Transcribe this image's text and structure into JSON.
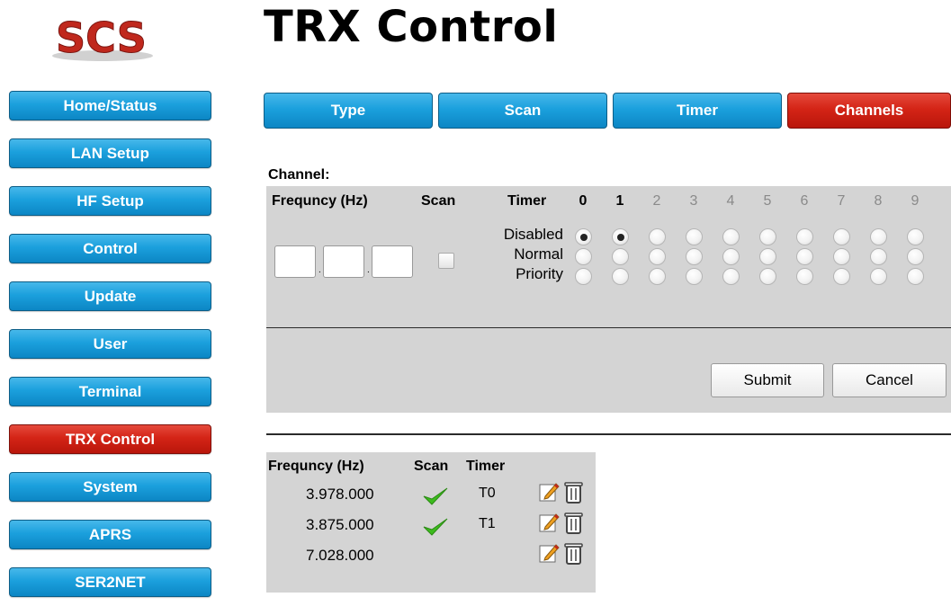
{
  "logo": {
    "text": "SCS"
  },
  "page": {
    "title": "TRX Control"
  },
  "sidebar": {
    "items": [
      {
        "label": "Home/Status",
        "active": false
      },
      {
        "label": "LAN Setup",
        "active": false
      },
      {
        "label": "HF Setup",
        "active": false
      },
      {
        "label": "Control",
        "active": false
      },
      {
        "label": "Update",
        "active": false
      },
      {
        "label": "User",
        "active": false
      },
      {
        "label": "Terminal",
        "active": false
      },
      {
        "label": "TRX Control",
        "active": true
      },
      {
        "label": "System",
        "active": false
      },
      {
        "label": "APRS",
        "active": false
      },
      {
        "label": "SER2NET",
        "active": false
      }
    ]
  },
  "tabs": [
    {
      "label": "Type",
      "active": false
    },
    {
      "label": "Scan",
      "active": false
    },
    {
      "label": "Timer",
      "active": false
    },
    {
      "label": "Channels",
      "active": true
    }
  ],
  "channel_form": {
    "section_label": "Channel:",
    "headers": {
      "frequency": "Frequncy (Hz)",
      "scan": "Scan",
      "timer": "Timer"
    },
    "timer_indices": [
      {
        "label": "0",
        "enabled": true
      },
      {
        "label": "1",
        "enabled": true
      },
      {
        "label": "2",
        "enabled": false
      },
      {
        "label": "3",
        "enabled": false
      },
      {
        "label": "4",
        "enabled": false
      },
      {
        "label": "5",
        "enabled": false
      },
      {
        "label": "6",
        "enabled": false
      },
      {
        "label": "7",
        "enabled": false
      },
      {
        "label": "8",
        "enabled": false
      },
      {
        "label": "9",
        "enabled": false
      }
    ],
    "modes": [
      "Disabled",
      "Normal",
      "Priority"
    ],
    "selected_mode_by_timer": [
      "Disabled",
      "Disabled",
      null,
      null,
      null,
      null,
      null,
      null,
      null,
      null
    ],
    "frequency_fields": [
      "",
      "",
      ""
    ],
    "scan_checked": false,
    "submit_label": "Submit",
    "cancel_label": "Cancel"
  },
  "channel_list": {
    "headers": {
      "frequency": "Frequncy (Hz)",
      "scan": "Scan",
      "timer": "Timer"
    },
    "rows": [
      {
        "frequency": "3.978.000",
        "scan": true,
        "timer": "T0"
      },
      {
        "frequency": "3.875.000",
        "scan": true,
        "timer": "T1"
      },
      {
        "frequency": "7.028.000",
        "scan": false,
        "timer": ""
      }
    ]
  },
  "colors": {
    "nav_blue": "#1ba0dd",
    "nav_active_red": "#d42416",
    "panel_gray": "#d4d4d4",
    "check_green": "#3dbb1e"
  },
  "icons": {
    "scan_check": "checkmark-icon",
    "edit": "edit-icon",
    "delete": "trash-icon"
  }
}
